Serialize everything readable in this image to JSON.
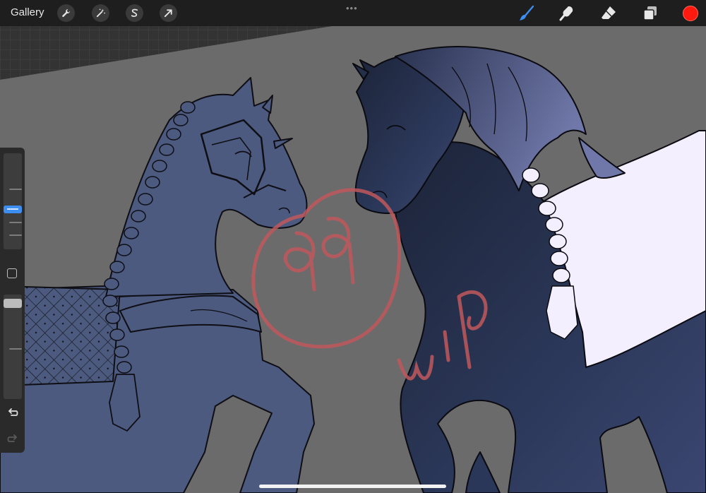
{
  "toolbar": {
    "gallery_label": "Gallery",
    "left_tools": [
      {
        "name": "actions",
        "icon": "wrench-icon"
      },
      {
        "name": "adjustments",
        "icon": "magic-wand-icon"
      },
      {
        "name": "selection",
        "icon": "selection-s-icon"
      },
      {
        "name": "transform",
        "icon": "arrow-cursor-icon"
      }
    ],
    "more_label": "•••",
    "right_tools": [
      {
        "name": "brush",
        "icon": "brush-icon",
        "active": true
      },
      {
        "name": "smudge",
        "icon": "smudge-finger-icon"
      },
      {
        "name": "eraser",
        "icon": "eraser-icon"
      },
      {
        "name": "layers",
        "icon": "layers-icon"
      }
    ],
    "current_color": "#ff1a0f",
    "active_tool_color": "#3c8ff0"
  },
  "sidebar": {
    "brush_size_level": 0.22,
    "brush_opacity_level": 0.02,
    "tools": [
      "modify-square-icon",
      "undo-icon",
      "redo-icon"
    ]
  },
  "canvas": {
    "background_color": "#6b6b6b",
    "left_horse_color": "#4c5a80",
    "right_horse_color": "#23304a",
    "white_patch_color": "#f4efff",
    "watermark_color": "#c0585c"
  }
}
